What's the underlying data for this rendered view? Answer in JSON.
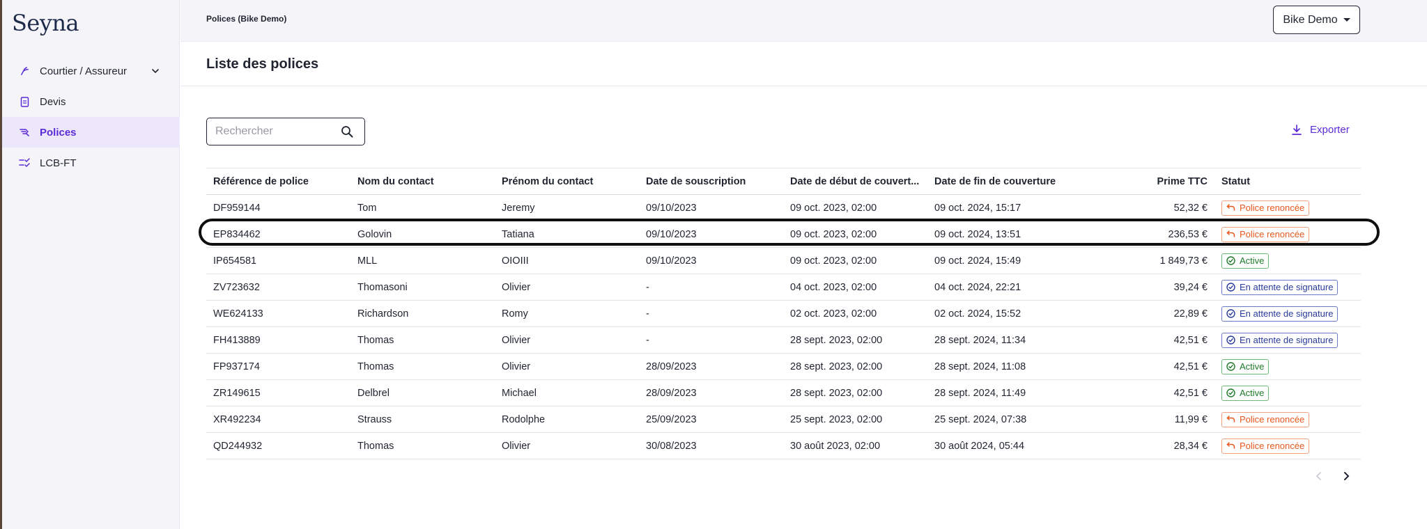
{
  "app": {
    "logo": "Seyna"
  },
  "sidebar": {
    "items": [
      {
        "label": "Courtier / Assureur",
        "icon": "broker-icon",
        "has_submenu": true
      },
      {
        "label": "Devis",
        "icon": "document-icon"
      },
      {
        "label": "Polices",
        "icon": "policy-icon",
        "active": true
      },
      {
        "label": "LCB-FT",
        "icon": "checklist-icon"
      }
    ]
  },
  "header": {
    "breadcrumb": "Polices (Bike Demo)",
    "org_selector": "Bike Demo"
  },
  "page": {
    "title": "Liste des polices",
    "search_placeholder": "Rechercher",
    "export_label": "Exporter"
  },
  "colors": {
    "accent": "#5b2bd6",
    "status_renounced": "#e8581e",
    "status_active": "#1f7a2a",
    "status_pending": "#2a3b9a"
  },
  "table": {
    "columns": [
      "Référence de police",
      "Nom du contact",
      "Prénom du contact",
      "Date de souscription",
      "Date de début de couvert...",
      "Date de fin de couverture",
      "Prime TTC",
      "Statut"
    ],
    "rows": [
      {
        "ref": "DF959144",
        "nom": "Tom",
        "prenom": "Jeremy",
        "souscription": "09/10/2023",
        "debut": "09 oct. 2023, 02:00",
        "fin": "09 oct. 2024, 15:17",
        "prime": "52,32 €",
        "statut": "Police renoncée",
        "statut_type": "renounced"
      },
      {
        "ref": "EP834462",
        "nom": "Golovin",
        "prenom": "Tatiana",
        "souscription": "09/10/2023",
        "debut": "09 oct. 2023, 02:00",
        "fin": "09 oct. 2024, 13:51",
        "prime": "236,53 €",
        "statut": "Police renoncée",
        "statut_type": "renounced"
      },
      {
        "ref": "IP654581",
        "nom": "MLL",
        "prenom": "OIOIII",
        "souscription": "09/10/2023",
        "debut": "09 oct. 2023, 02:00",
        "fin": "09 oct. 2024, 15:49",
        "prime": "1 849,73 €",
        "statut": "Active",
        "statut_type": "active"
      },
      {
        "ref": "ZV723632",
        "nom": "Thomasoni",
        "prenom": "Olivier",
        "souscription": "-",
        "debut": "04 oct. 2023, 02:00",
        "fin": "04 oct. 2024, 22:21",
        "prime": "39,24 €",
        "statut": "En attente de signature",
        "statut_type": "pending"
      },
      {
        "ref": "WE624133",
        "nom": "Richardson",
        "prenom": "Romy",
        "souscription": "-",
        "debut": "02 oct. 2023, 02:00",
        "fin": "02 oct. 2024, 15:52",
        "prime": "22,89 €",
        "statut": "En attente de signature",
        "statut_type": "pending"
      },
      {
        "ref": "FH413889",
        "nom": "Thomas",
        "prenom": "Olivier",
        "souscription": "-",
        "debut": "28 sept. 2023, 02:00",
        "fin": "28 sept. 2024, 11:34",
        "prime": "42,51 €",
        "statut": "En attente de signature",
        "statut_type": "pending"
      },
      {
        "ref": "FP937174",
        "nom": "Thomas",
        "prenom": "Olivier",
        "souscription": "28/09/2023",
        "debut": "28 sept. 2023, 02:00",
        "fin": "28 sept. 2024, 11:08",
        "prime": "42,51 €",
        "statut": "Active",
        "statut_type": "active"
      },
      {
        "ref": "ZR149615",
        "nom": "Delbrel",
        "prenom": "Michael",
        "souscription": "28/09/2023",
        "debut": "28 sept. 2023, 02:00",
        "fin": "28 sept. 2024, 11:49",
        "prime": "42,51 €",
        "statut": "Active",
        "statut_type": "active"
      },
      {
        "ref": "XR492234",
        "nom": "Strauss",
        "prenom": "Rodolphe",
        "souscription": "25/09/2023",
        "debut": "25 sept. 2023, 02:00",
        "fin": "25 sept. 2024, 07:38",
        "prime": "11,99 €",
        "statut": "Police renoncée",
        "statut_type": "renounced"
      },
      {
        "ref": "QD244932",
        "nom": "Thomas",
        "prenom": "Olivier",
        "souscription": "30/08/2023",
        "debut": "30 août 2023, 02:00",
        "fin": "30 août 2024, 05:44",
        "prime": "28,34 €",
        "statut": "Police renoncée",
        "statut_type": "renounced"
      }
    ]
  }
}
